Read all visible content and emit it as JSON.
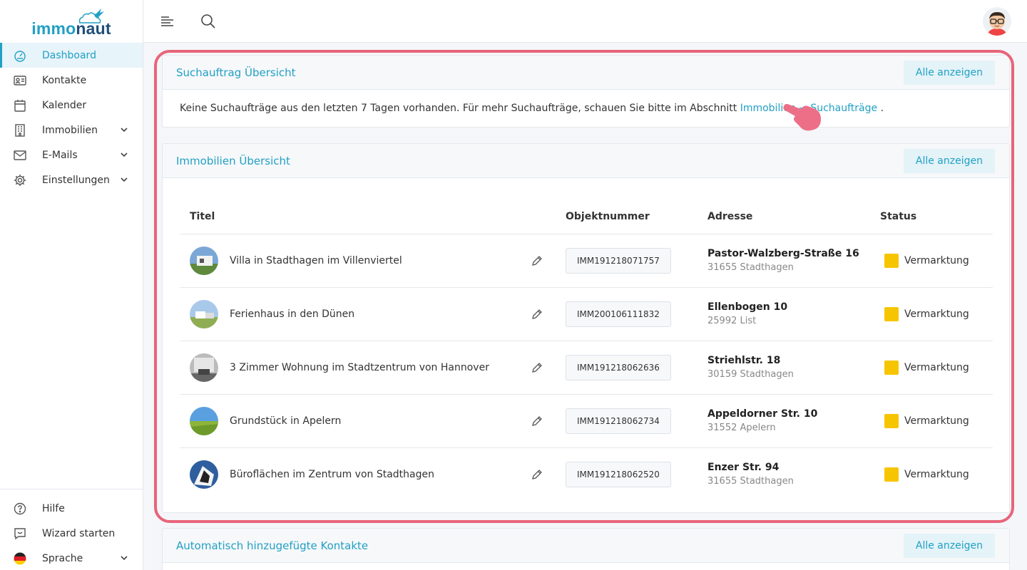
{
  "brand": {
    "part1": "immo",
    "part2": "naut"
  },
  "sidebar": {
    "items": [
      {
        "label": "Dashboard",
        "icon": "dashboard-icon",
        "active": true
      },
      {
        "label": "Kontakte",
        "icon": "contacts-icon"
      },
      {
        "label": "Kalender",
        "icon": "calendar-icon"
      },
      {
        "label": "Immobilien",
        "icon": "building-icon"
      },
      {
        "label": "E-Mails",
        "icon": "mail-icon"
      },
      {
        "label": "Einstellungen",
        "icon": "gear-icon"
      }
    ],
    "bottom": [
      {
        "label": "Hilfe",
        "icon": "help-icon"
      },
      {
        "label": "Wizard starten",
        "icon": "wizard-icon"
      },
      {
        "label": "Sprache",
        "icon": "german-flag-icon"
      }
    ]
  },
  "colors": {
    "accent": "#21a0c4",
    "highlight": "#e8647a",
    "status_yellow": "#f7c500"
  },
  "search_card": {
    "title": "Suchauftrag Übersicht",
    "button": "Alle anzeigen",
    "message": "Keine Suchaufträge aus den letzten 7 Tagen vorhanden. Für mehr Suchaufträge, schauen Sie bitte im Abschnitt",
    "link": "Immobilien → Suchaufträge",
    "message_end": "."
  },
  "property_card": {
    "title": "Immobilien Übersicht",
    "button": "Alle anzeigen",
    "columns": {
      "title": "Titel",
      "objnr": "Objektnummer",
      "address": "Adresse",
      "status": "Status"
    },
    "rows": [
      {
        "title": "Villa in Stadthagen im Villenviertel",
        "objnr": "IMM191218071757",
        "street": "Pastor-Walzberg-Straße 16",
        "city": "31655 Stadthagen",
        "status": "Vermarktung"
      },
      {
        "title": "Ferienhaus in den Dünen",
        "objnr": "IMM200106111832",
        "street": "Ellenbogen 10",
        "city": "25992 List",
        "status": "Vermarktung"
      },
      {
        "title": "3 Zimmer Wohnung im Stadtzentrum von Hannover",
        "objnr": "IMM191218062636",
        "street": "Striehlstr. 18",
        "city": "30159 Stadthagen",
        "status": "Vermarktung"
      },
      {
        "title": "Grundstück in Apelern",
        "objnr": "IMM191218062734",
        "street": "Appeldorner Str. 10",
        "city": "31552 Apelern",
        "status": "Vermarktung"
      },
      {
        "title": "Büroflächen im Zentrum von Stadthagen",
        "objnr": "IMM191218062520",
        "street": "Enzer Str. 94",
        "city": "31655 Stadthagen",
        "status": "Vermarktung"
      }
    ]
  },
  "contacts_card": {
    "title": "Automatisch hinzugefügte Kontakte",
    "button": "Alle anzeigen"
  }
}
